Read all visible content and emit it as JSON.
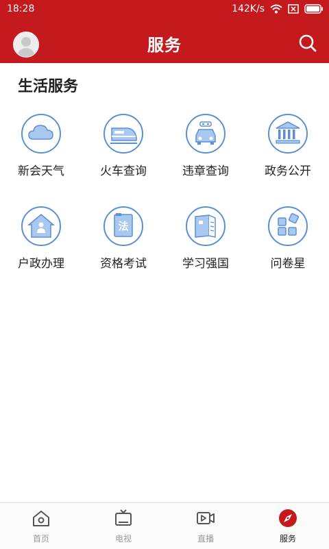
{
  "status_bar": {
    "time": "18:28",
    "net_speed": "142K/s"
  },
  "header": {
    "title": "服务"
  },
  "section": {
    "title": "生活服务"
  },
  "services": [
    {
      "label": "新会天气",
      "icon": "cloud-icon"
    },
    {
      "label": "火车查询",
      "icon": "train-icon"
    },
    {
      "label": "违章查询",
      "icon": "car-icon"
    },
    {
      "label": "政务公开",
      "icon": "government-building-icon"
    },
    {
      "label": "户政办理",
      "icon": "household-house-icon"
    },
    {
      "label": "资格考试",
      "icon": "law-book-icon"
    },
    {
      "label": "学习强国",
      "icon": "study-book-icon"
    },
    {
      "label": "问卷星",
      "icon": "grid-blocks-icon"
    }
  ],
  "tabs": [
    {
      "label": "首页",
      "icon": "home-icon",
      "active": false
    },
    {
      "label": "电视",
      "icon": "tv-icon",
      "active": false
    },
    {
      "label": "直播",
      "icon": "live-video-icon",
      "active": false
    },
    {
      "label": "服务",
      "icon": "compass-icon",
      "active": true
    }
  ],
  "colors": {
    "brand_red": "#c4191d",
    "icon_blue": "#5b8fd4",
    "icon_fill": "#a9c8f0",
    "tab_inactive": "#9a9a9a"
  }
}
